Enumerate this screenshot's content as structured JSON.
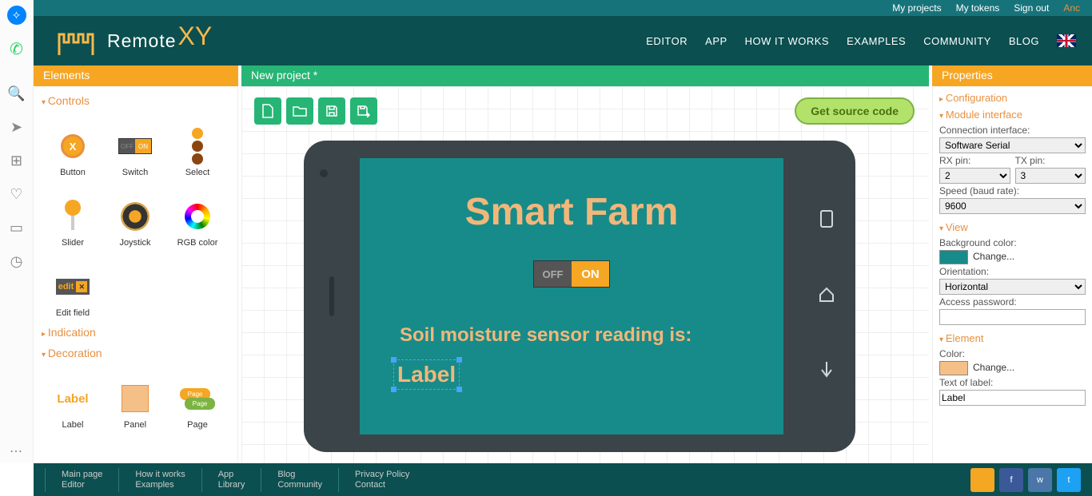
{
  "topbar": {
    "my_projects": "My projects",
    "my_tokens": "My tokens",
    "sign_out": "Sign out",
    "anc": "Anc"
  },
  "nav": {
    "editor": "EDITOR",
    "app": "APP",
    "how": "HOW IT WORKS",
    "examples": "EXAMPLES",
    "community": "COMMUNITY",
    "blog": "BLOG"
  },
  "titles": {
    "elements": "Elements",
    "project": "New project *",
    "properties": "Properties"
  },
  "sections": {
    "controls": "Controls",
    "indication": "Indication",
    "decoration": "Decoration"
  },
  "elements": {
    "button": "Button",
    "switch": "Switch",
    "select": "Select",
    "slider": "Slider",
    "joystick": "Joystick",
    "rgb": "RGB color",
    "edit": "Edit field",
    "label": "Label",
    "panel": "Panel",
    "page": "Page"
  },
  "toolbar": {
    "get_code": "Get source code"
  },
  "app": {
    "title": "Smart Farm",
    "off": "OFF",
    "on": "ON",
    "reading": "Soil moisture sensor reading is:",
    "label_text": "Label"
  },
  "props": {
    "configuration": "Configuration",
    "module_interface": "Module interface",
    "conn_iface_label": "Connection interface:",
    "conn_iface": "Software Serial",
    "rx_label": "RX pin:",
    "rx": "2",
    "tx_label": "TX pin:",
    "tx": "3",
    "speed_label": "Speed (baud rate):",
    "speed": "9600",
    "view": "View",
    "bg_label": "Background color:",
    "change": "Change...",
    "bg_color": "#178b89",
    "orient_label": "Orientation:",
    "orient": "Horizontal",
    "pass_label": "Access password:",
    "pass": "",
    "element": "Element",
    "color_label": "Color:",
    "el_color": "#f5c088",
    "text_label": "Text of label:",
    "text_val": "Label"
  },
  "footer": {
    "c1a": "Main page",
    "c1b": "Editor",
    "c2a": "How it works",
    "c2b": "Examples",
    "c3a": "App",
    "c3b": "Library",
    "c4a": "Blog",
    "c4b": "Community",
    "c5a": "Privacy Policy",
    "c5b": "Contact"
  }
}
